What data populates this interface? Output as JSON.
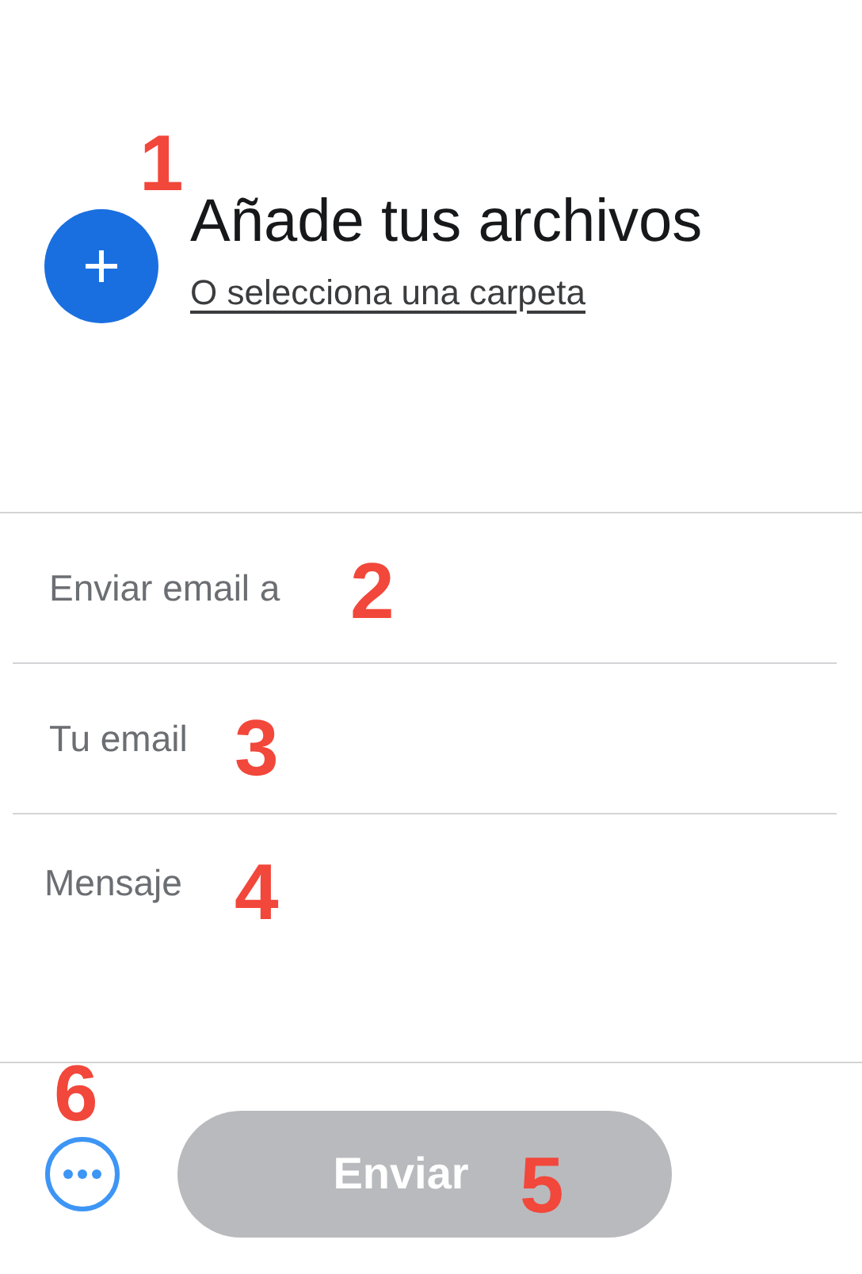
{
  "upload": {
    "title": "Añade tus archivos",
    "link": "O selecciona una carpeta",
    "annotation": "1"
  },
  "fields": [
    {
      "kind": "line",
      "placeholder": "Enviar email a",
      "annotation": "2"
    },
    {
      "kind": "line",
      "placeholder": "Tu email",
      "annotation": "3"
    },
    {
      "kind": "area",
      "placeholder": "Mensaje",
      "annotation": "4"
    }
  ],
  "footer": {
    "more_annotation": "6",
    "send_button": {
      "label": "Enviar",
      "disabled": true,
      "annotation": "5"
    }
  }
}
